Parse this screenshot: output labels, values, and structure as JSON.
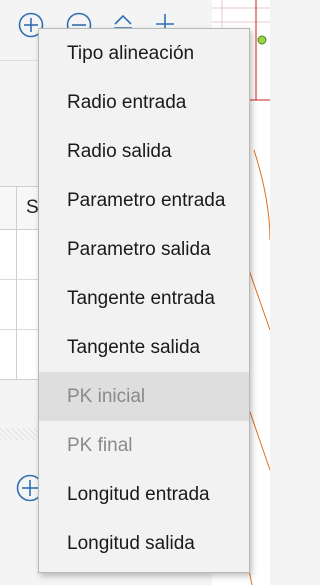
{
  "grid": {
    "header_partial": "Se"
  },
  "menu": {
    "items": [
      {
        "label": "Tipo alineación",
        "enabled": true
      },
      {
        "label": "Radio entrada",
        "enabled": true
      },
      {
        "label": "Radio salida",
        "enabled": true
      },
      {
        "label": "Parametro entrada",
        "enabled": true
      },
      {
        "label": "Parametro salida",
        "enabled": true
      },
      {
        "label": "Tangente entrada",
        "enabled": true
      },
      {
        "label": "Tangente salida",
        "enabled": true
      },
      {
        "label": "PK inicial",
        "enabled": false,
        "highlighted": true
      },
      {
        "label": "PK final",
        "enabled": false
      },
      {
        "label": "Longitud entrada",
        "enabled": true
      },
      {
        "label": "Longitud salida",
        "enabled": true
      }
    ]
  },
  "icons": {
    "add": "plus-circle-icon",
    "remove": "minus-circle-icon",
    "move_up": "move-up-icon",
    "align": "align-icon"
  },
  "colors": {
    "accent": "#2f6fb3",
    "canvas_line": "#e07020",
    "canvas_red": "#d02020"
  }
}
